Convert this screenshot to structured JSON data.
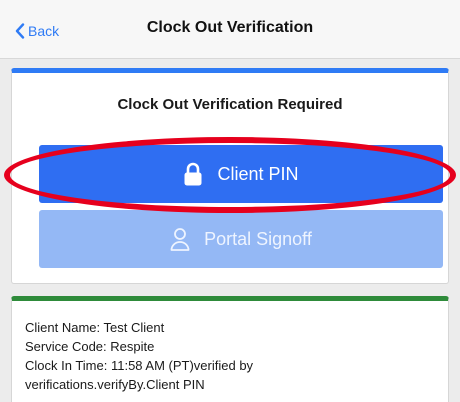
{
  "header": {
    "back_label": "Back",
    "title": "Clock Out Verification"
  },
  "verification_card": {
    "heading": "Clock Out Verification Required",
    "pin_button_label": "Client PIN",
    "portal_button_label": "Portal Signoff"
  },
  "info_card": {
    "lines": [
      "Client Name: Test Client",
      "Service Code: Respite",
      "Clock In Time: 11:58 AM (PT)verified by",
      "verifications.verifyBy.Client PIN"
    ]
  },
  "colors": {
    "accent_blue": "#2f6ef2",
    "portal_button_blue": "#94b8f5",
    "verify_card_border": "#2f7bf5",
    "info_card_border": "#2e8b3a",
    "highlight_red": "#e6001d"
  },
  "icons": {
    "back": "chevron-left-icon",
    "pin": "lock-icon",
    "portal": "person-icon"
  }
}
